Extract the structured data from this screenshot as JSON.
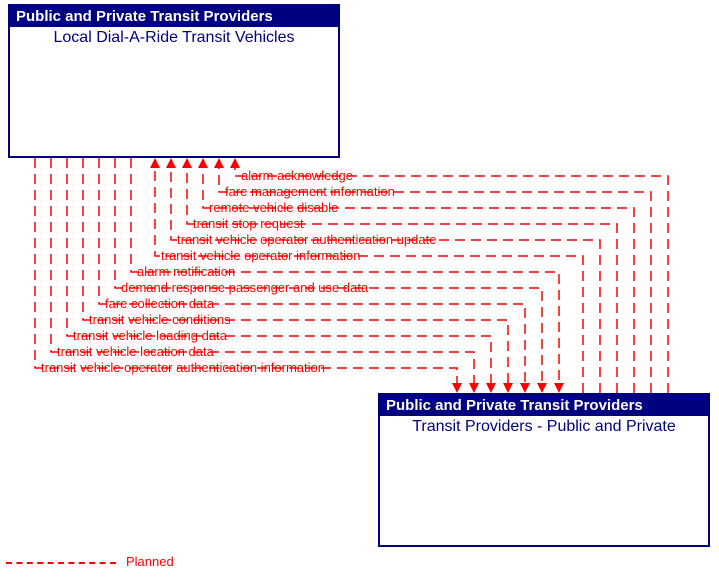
{
  "boxes": {
    "source": {
      "header": "Public and Private Transit Providers",
      "title": "Local Dial-A-Ride Transit Vehicles"
    },
    "dest": {
      "header": "Public and Private Transit Providers",
      "title": "Transit Providers - Public and Private"
    }
  },
  "flows_top_down": [
    "alarm acknowledge",
    "fare management information",
    "remote vehicle disable",
    "transit stop request",
    "transit vehicle operator authentication update",
    "transit vehicle operator information"
  ],
  "flows_bottom_up": [
    "alarm notification",
    "demand response passenger and use data",
    "fare collection data",
    "transit vehicle conditions",
    "transit vehicle loading data",
    "transit vehicle location data",
    "transit vehicle operator authentication information"
  ],
  "legend": {
    "planned": "Planned"
  },
  "chart_data": {
    "type": "diagram",
    "nodes": [
      {
        "id": "vehicles",
        "group": "Public and Private Transit Providers",
        "label": "Local Dial-A-Ride Transit Vehicles"
      },
      {
        "id": "providers",
        "group": "Public and Private Transit Providers",
        "label": "Transit Providers - Public and Private"
      }
    ],
    "edges": [
      {
        "from": "providers",
        "to": "vehicles",
        "label": "alarm acknowledge",
        "status": "Planned"
      },
      {
        "from": "providers",
        "to": "vehicles",
        "label": "fare management information",
        "status": "Planned"
      },
      {
        "from": "providers",
        "to": "vehicles",
        "label": "remote vehicle disable",
        "status": "Planned"
      },
      {
        "from": "providers",
        "to": "vehicles",
        "label": "transit stop request",
        "status": "Planned"
      },
      {
        "from": "providers",
        "to": "vehicles",
        "label": "transit vehicle operator authentication update",
        "status": "Planned"
      },
      {
        "from": "providers",
        "to": "vehicles",
        "label": "transit vehicle operator information",
        "status": "Planned"
      },
      {
        "from": "vehicles",
        "to": "providers",
        "label": "alarm notification",
        "status": "Planned"
      },
      {
        "from": "vehicles",
        "to": "providers",
        "label": "demand response passenger and use data",
        "status": "Planned"
      },
      {
        "from": "vehicles",
        "to": "providers",
        "label": "fare collection data",
        "status": "Planned"
      },
      {
        "from": "vehicles",
        "to": "providers",
        "label": "transit vehicle conditions",
        "status": "Planned"
      },
      {
        "from": "vehicles",
        "to": "providers",
        "label": "transit vehicle loading data",
        "status": "Planned"
      },
      {
        "from": "vehicles",
        "to": "providers",
        "label": "transit vehicle location data",
        "status": "Planned"
      },
      {
        "from": "vehicles",
        "to": "providers",
        "label": "transit vehicle operator authentication information",
        "status": "Planned"
      }
    ],
    "legend": {
      "Planned": "red dashed line"
    }
  }
}
